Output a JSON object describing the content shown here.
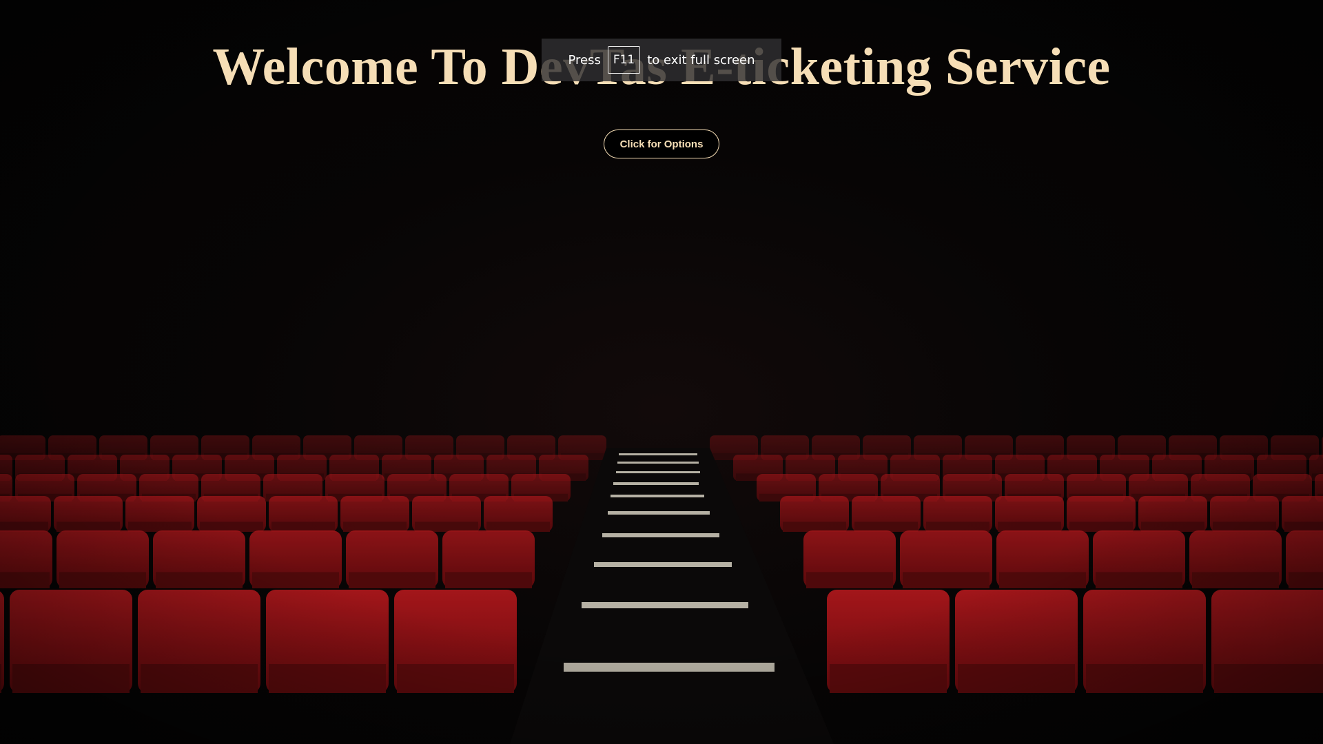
{
  "page": {
    "title": "Welcome To DevTas E-ticketing Service",
    "options_button": "Click for Options"
  },
  "fullscreen_notice": {
    "press": "Press",
    "key": "F11",
    "message": "to exit full screen"
  },
  "colors": {
    "title": "#f6deb6",
    "seat": "#8e0f12",
    "background": "#050404"
  },
  "background_image": "cinema-seats-image"
}
